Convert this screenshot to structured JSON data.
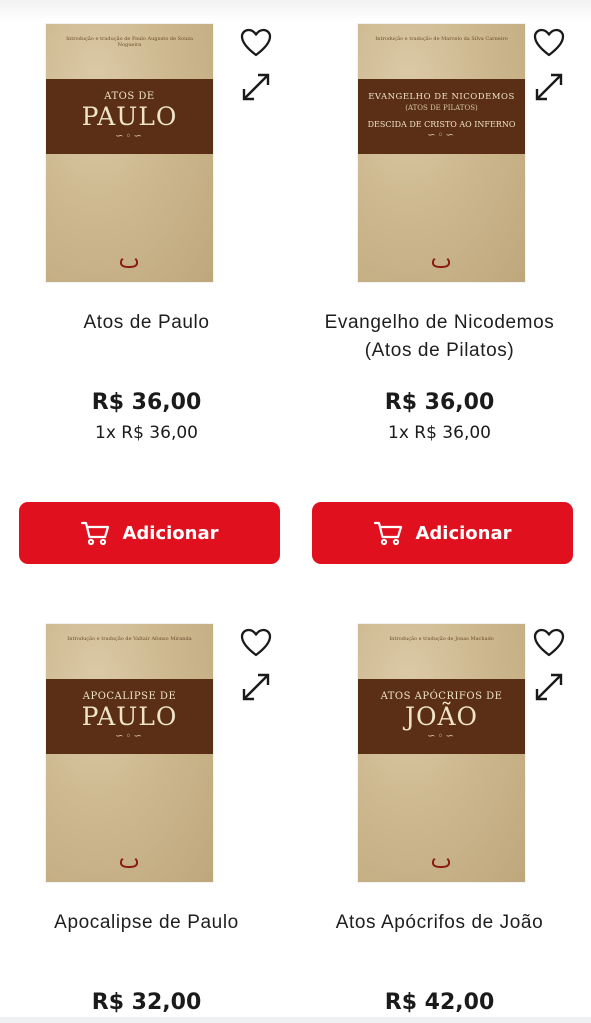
{
  "products": [
    {
      "cover": {
        "credit": "Introdução e tradução de Paulo Augusto de Souza Nogueira",
        "small_title": "ATOS DE",
        "big_title": "PAULO",
        "sub": "",
        "mid": ""
      },
      "title": "Atos de Paulo",
      "price": "R$ 36,00",
      "installment": "1x R$ 36,00",
      "add_label": "Adicionar"
    },
    {
      "cover": {
        "credit": "Introdução e tradução de Marcelo da Silva Carneiro",
        "small_title": "EVANGELHO DE NICODEMOS",
        "big_title": "",
        "sub": "(ATOS DE PILATOS)",
        "mid": "DESCIDA DE CRISTO AO INFERNO"
      },
      "title": "Evangelho de Nicodemos (Atos de Pilatos)",
      "price": "R$ 36,00",
      "installment": "1x R$ 36,00",
      "add_label": "Adicionar"
    },
    {
      "cover": {
        "credit": "Introdução e tradução de Valtair Afonso Miranda",
        "small_title": "APOCALIPSE DE",
        "big_title": "PAULO",
        "sub": "",
        "mid": ""
      },
      "title": "Apocalipse de Paulo",
      "price": "R$ 32,00"
    },
    {
      "cover": {
        "credit": "Introdução e tradução de Jonas Machado",
        "small_title": "ATOS APÓCRIFOS DE",
        "big_title": "JOÃO",
        "sub": "",
        "mid": ""
      },
      "title": "Atos Apócrifos de João",
      "price": "R$ 42,00"
    }
  ],
  "icons": {
    "favorite": "heart-outline-icon",
    "expand": "expand-arrows-icon",
    "cart": "cart-icon"
  },
  "colors": {
    "button": "#e0101f",
    "cover_band": "#5a2f16",
    "cover_paper": "#cdb88f"
  }
}
